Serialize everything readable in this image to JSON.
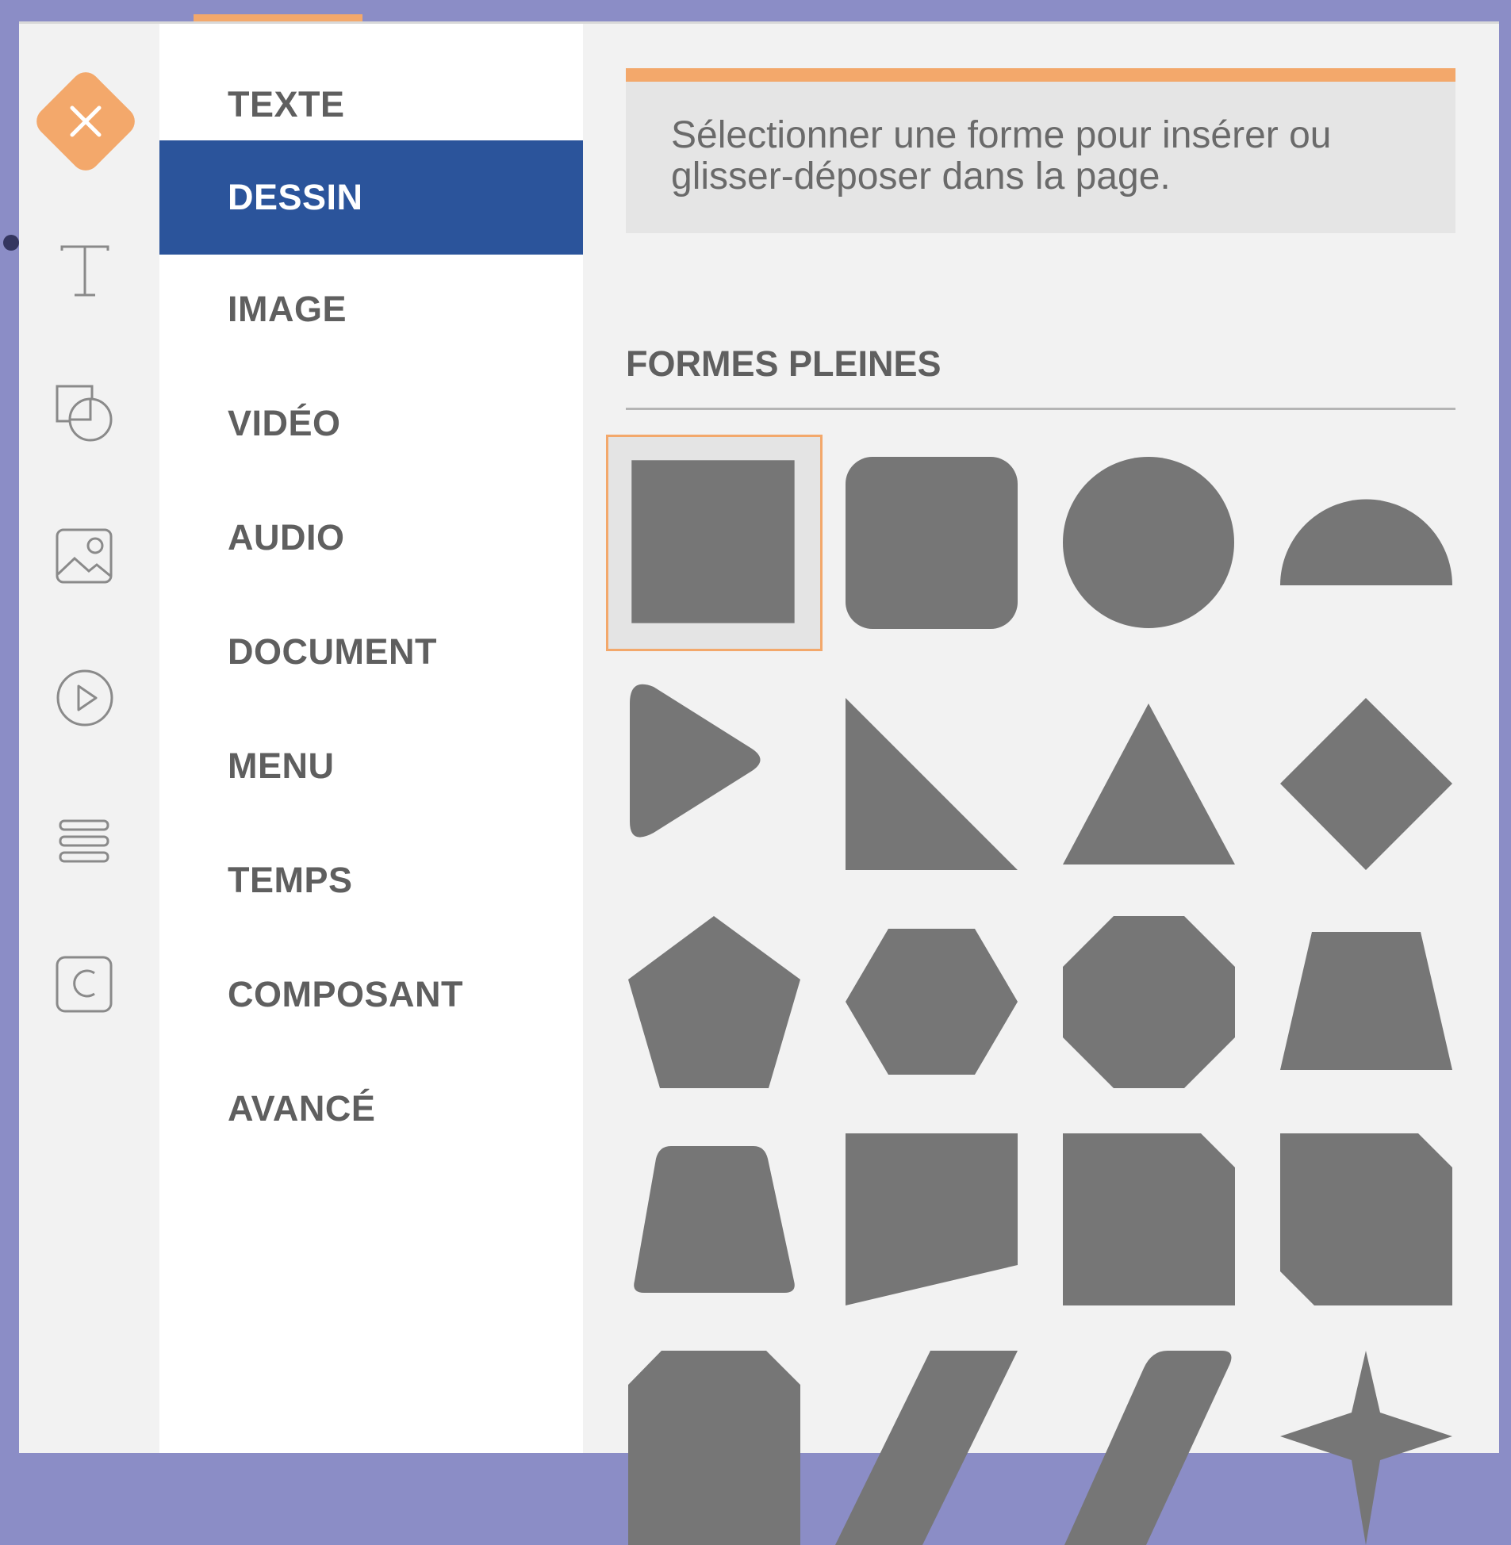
{
  "menu": {
    "items": [
      {
        "label": "TEXTE"
      },
      {
        "label": "DESSIN"
      },
      {
        "label": "IMAGE"
      },
      {
        "label": "VIDÉO"
      },
      {
        "label": "AUDIO"
      },
      {
        "label": "DOCUMENT"
      },
      {
        "label": "MENU"
      },
      {
        "label": "TEMPS"
      },
      {
        "label": "COMPOSANT"
      },
      {
        "label": "AVANCÉ"
      }
    ],
    "active": "DESSIN"
  },
  "rail": {
    "icons": [
      "close-icon",
      "text-icon",
      "shapes-icon",
      "image-icon",
      "video-icon",
      "menu-icon",
      "copyright-icon"
    ]
  },
  "panel": {
    "hint": "Sélectionner une forme pour insérer ou glisser-déposer dans la page.",
    "section_title": "FORMES PLEINES",
    "shapes": [
      "square",
      "rounded-square",
      "circle",
      "semicircle",
      "rounded-triangle-right",
      "right-triangle",
      "triangle",
      "diamond",
      "pentagon",
      "hexagon",
      "octagon",
      "trapezoid",
      "rounded-trapezoid",
      "slanted-quadrilateral",
      "snipped-corner-rectangle",
      "snipped-two-corner-rectangle",
      "top-snipped-rectangle",
      "parallelogram",
      "rounded-parallelogram",
      "four-point-star"
    ],
    "selected_shape": "square"
  },
  "colors": {
    "accent": "#f3a86b",
    "active_menu": "#2b549b",
    "shape_fill": "#767676",
    "outer_background": "#8b8dc6"
  }
}
